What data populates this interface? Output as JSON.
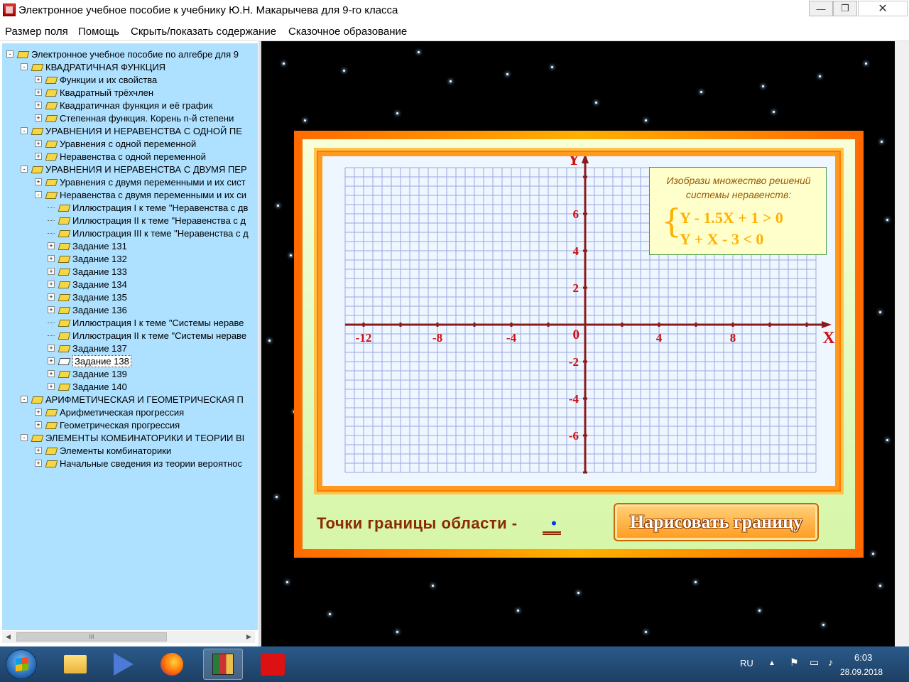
{
  "window": {
    "title": "Электронное учебное пособие к учебнику Ю.Н. Макарычева для 9-го класса"
  },
  "menu": [
    "Размер поля",
    "Помощь",
    "Скрыть/показать содержание",
    "Сказочное образование"
  ],
  "tree": [
    {
      "label": "Электронное учебное пособие по алгебре для 9",
      "level": 0,
      "toggle": "-"
    },
    {
      "label": "КВАДРАТИЧНАЯ ФУНКЦИЯ",
      "level": 1,
      "toggle": "-"
    },
    {
      "label": "Функции и их свойства",
      "level": 2,
      "toggle": "+"
    },
    {
      "label": "Квадратный трёхчлен",
      "level": 2,
      "toggle": "+"
    },
    {
      "label": "Квадратичная функция и её график",
      "level": 2,
      "toggle": "+"
    },
    {
      "label": "Степенная функция. Корень n-й степени",
      "level": 2,
      "toggle": "+"
    },
    {
      "label": "УРАВНЕНИЯ И НЕРАВЕНСТВА С ОДНОЙ ПЕ",
      "level": 1,
      "toggle": "-"
    },
    {
      "label": "Уравнения с одной переменной",
      "level": 2,
      "toggle": "+"
    },
    {
      "label": "Неравенства с одной переменной",
      "level": 2,
      "toggle": "+"
    },
    {
      "label": "УРАВНЕНИЯ И НЕРАВЕНСТВА С ДВУМЯ ПЕР",
      "level": 1,
      "toggle": "-"
    },
    {
      "label": "Уравнения с двумя переменными и их сист",
      "level": 2,
      "toggle": "+"
    },
    {
      "label": "Неравенства с двумя переменными и их си",
      "level": 2,
      "toggle": "-"
    },
    {
      "label": "Иллюстрация I к теме \"Неравенства с дв",
      "level": 3,
      "toggle": ""
    },
    {
      "label": "Иллюстрация II к теме \"Неравенства с д",
      "level": 3,
      "toggle": ""
    },
    {
      "label": "Иллюстрация III к теме \"Неравенства с д",
      "level": 3,
      "toggle": ""
    },
    {
      "label": "Задание 131",
      "level": 3,
      "toggle": "+"
    },
    {
      "label": "Задание 132",
      "level": 3,
      "toggle": "+"
    },
    {
      "label": "Задание 133",
      "level": 3,
      "toggle": "+"
    },
    {
      "label": "Задание 134",
      "level": 3,
      "toggle": "+"
    },
    {
      "label": "Задание 135",
      "level": 3,
      "toggle": "+"
    },
    {
      "label": "Задание 136",
      "level": 3,
      "toggle": "+"
    },
    {
      "label": "Иллюстрация I к теме \"Системы нераве",
      "level": 3,
      "toggle": ""
    },
    {
      "label": "Иллюстрация II к теме \"Системы нераве",
      "level": 3,
      "toggle": ""
    },
    {
      "label": "Задание 137",
      "level": 3,
      "toggle": "+"
    },
    {
      "label": "Задание 138",
      "level": 3,
      "toggle": "+",
      "selected": true
    },
    {
      "label": "Задание 139",
      "level": 3,
      "toggle": "+"
    },
    {
      "label": "Задание 140",
      "level": 3,
      "toggle": "+"
    },
    {
      "label": "АРИФМЕТИЧЕСКАЯ И ГЕОМЕТРИЧЕСКАЯ П",
      "level": 1,
      "toggle": "-"
    },
    {
      "label": "Арифметическая прогрессия",
      "level": 2,
      "toggle": "+"
    },
    {
      "label": "Геометрическая прогрессия",
      "level": 2,
      "toggle": "+"
    },
    {
      "label": "ЭЛЕМЕНТЫ КОМБИНАТОРИКИ И ТЕОРИИ ВІ",
      "level": 1,
      "toggle": "-"
    },
    {
      "label": "Элементы комбинаторики",
      "level": 2,
      "toggle": "+"
    },
    {
      "label": "Начальные сведения из теории вероятнос",
      "level": 2,
      "toggle": "+"
    }
  ],
  "scrollbar": {
    "thumb_label": "III",
    "left_arrow": "◀",
    "right_arrow": "▶"
  },
  "graph": {
    "x_axis_label": "X",
    "y_axis_label": "Y",
    "origin_label": "0",
    "x_ticks": [
      -12,
      -8,
      -4,
      4,
      8
    ],
    "y_ticks": [
      6,
      4,
      2,
      -2,
      -4,
      -6
    ],
    "x_range": [
      -13,
      12.5
    ],
    "y_range": [
      -8,
      8.5
    ],
    "axis_color": "#8b1a1a",
    "grid_color": "#9aa8e0",
    "label_color": "#d01010"
  },
  "task": {
    "title_line1": "Изобрази множество решений",
    "title_line2": "системы неравенств:",
    "brace": "{",
    "inequality1": "Y - 1.5X + 1 > 0",
    "inequality2": "Y + X - 3 < 0"
  },
  "points": {
    "label": "Точки границы области -",
    "value": "•"
  },
  "draw_button": "Нарисовать границу",
  "taskbar": {
    "lang": "RU",
    "time": "6:03",
    "date": "28.09.2018",
    "tray_up_arrow": "▲",
    "tray_icons": [
      "flag-icon",
      "network-icon",
      "volume-icon"
    ]
  },
  "window_buttons": {
    "minimize": "—",
    "maximize": "❐",
    "close": "✕"
  }
}
